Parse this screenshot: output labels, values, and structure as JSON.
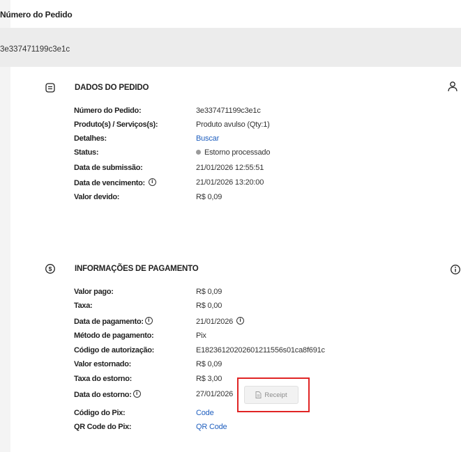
{
  "header": {
    "title": "Número do Pedido"
  },
  "order_id_bar": {
    "value": "3e337471199c3e1c"
  },
  "order_section": {
    "title": "DADOS DO PEDIDO",
    "rows": [
      {
        "label": "Número do Pedido:",
        "value": "3e337471199c3e1c"
      },
      {
        "label": "Produto(s) / Serviços(s):",
        "value": "Produto avulso (Qty:1)"
      },
      {
        "label": "Detalhes:",
        "value": "Buscar"
      },
      {
        "label": "Status:",
        "value": "Estorno processado"
      },
      {
        "label": "Data de submissão:",
        "value": "21/01/2026 12:55:51"
      },
      {
        "label": "Data de vencimento:",
        "value": "21/01/2026 13:20:00"
      },
      {
        "label": "Valor devido:",
        "value": "R$ 0,09"
      }
    ]
  },
  "payment_section": {
    "title": "INFORMAÇÕES DE PAGAMENTO",
    "rows": [
      {
        "label": "Valor pago:",
        "value": "R$ 0,09"
      },
      {
        "label": "Taxa:",
        "value": "R$ 0,00"
      },
      {
        "label": "Data de pagamento:",
        "value": "21/01/2026"
      },
      {
        "label": "Método de pagamento:",
        "value": "Pix"
      },
      {
        "label": "Código de autorização:",
        "value": "E18236120202601211556s01ca8f691c"
      },
      {
        "label": "Valor estornado:",
        "value": "R$ 0,09"
      },
      {
        "label": "Taxa do estorno:",
        "value": "R$ 3,00"
      },
      {
        "label": "Data do estorno:",
        "value": "27/01/2026"
      },
      {
        "label": "Código do Pix:",
        "value": "Code"
      },
      {
        "label": "QR Code do Pix:",
        "value": "QR Code"
      }
    ],
    "receipt_button": {
      "label": "Receipt",
      "icon": "document-icon"
    }
  },
  "info_glyph": "i",
  "colors": {
    "link": "#1f5fbf",
    "highlight_border": "#e02424",
    "status_dot": "#9a9a9a"
  }
}
